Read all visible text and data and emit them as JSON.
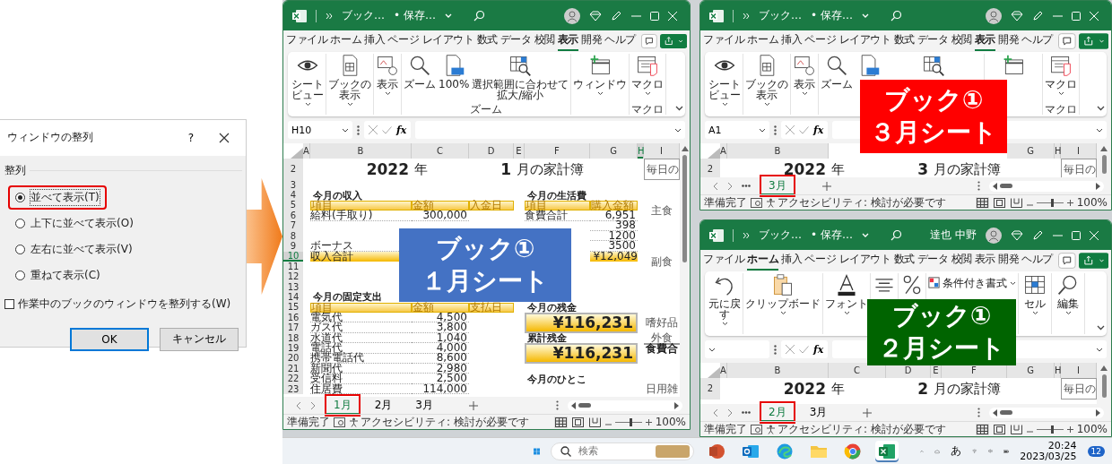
{
  "dialog": {
    "title": "ウィンドウの整列",
    "help": "?",
    "group_label": "整列",
    "options": [
      {
        "label": "並べて表示(T)",
        "selected": true,
        "highlighted": true
      },
      {
        "label": "上下に並べて表示(O)",
        "selected": false,
        "highlighted": false
      },
      {
        "label": "左右に並べて表示(V)",
        "selected": false,
        "highlighted": false
      },
      {
        "label": "重ねて表示(C)",
        "selected": false,
        "highlighted": false
      }
    ],
    "checkbox": {
      "label": "作業中のブックのウィンドウを整列する(W)",
      "checked": false
    },
    "buttons": [
      {
        "label": "OK",
        "default": true
      },
      {
        "label": "キャンセル",
        "default": false
      }
    ]
  },
  "windows": [
    {
      "title_bar": {
        "file": "ブック…",
        "save_state": "• 保存…"
      },
      "menu_tabs": [
        {
          "label": "ファイル",
          "selected": false
        },
        {
          "label": "ホーム",
          "selected": false
        },
        {
          "label": "挿入",
          "selected": false
        },
        {
          "label": "ページ レイアウト",
          "selected": false
        },
        {
          "label": "数式",
          "selected": false
        },
        {
          "label": "データ",
          "selected": false
        },
        {
          "label": "校閲",
          "selected": false
        },
        {
          "label": "表示",
          "selected": true
        },
        {
          "label": "開発",
          "selected": false
        },
        {
          "label": "ヘルプ",
          "selected": false
        }
      ],
      "ribbon_groups": [
        {
          "buttons": [
            {
              "kind": "eye",
              "label": "シートビュー",
              "dropdown": true
            }
          ]
        },
        {
          "buttons": [
            {
              "kind": "workbook",
              "label": "ブックの表示",
              "dropdown": true
            }
          ]
        },
        {
          "buttons": [
            {
              "kind": "display",
              "label": "表示",
              "dropdown": true
            }
          ]
        },
        {
          "label": "ズーム",
          "buttons": [
            {
              "kind": "zoom",
              "label": "ズーム",
              "dropdown": false
            },
            {
              "kind": "zoom100",
              "label": "100%",
              "dropdown": false
            },
            {
              "kind": "zoomsel",
              "label": "選択範囲に合わせて拡大/縮小",
              "dropdown": false
            }
          ]
        },
        {
          "buttons": [
            {
              "kind": "newwindow",
              "label": "ウィンドウ",
              "dropdown": true
            }
          ]
        },
        {
          "label": "マクロ",
          "buttons": [
            {
              "kind": "macro",
              "label": "マクロ",
              "dropdown": true
            }
          ]
        }
      ],
      "name_box": "H10",
      "fx": "fx",
      "column_headers": {
        "A": {
          "label": "A",
          "selected": false
        },
        "B": {
          "label": "B",
          "selected": false
        },
        "C": {
          "label": "C",
          "selected": false
        },
        "D": {
          "label": "D",
          "selected": false
        },
        "E": {
          "label": "E",
          "selected": false
        },
        "F": {
          "label": "F",
          "selected": false
        },
        "G": {
          "label": "G",
          "selected": false
        },
        "H": {
          "label": "H",
          "selected": true
        },
        "I": {
          "label": "I",
          "selected": false
        }
      },
      "rows": [
        {
          "num": "2",
          "selected": false,
          "cells": {
            "B": {
              "text": "2022",
              "kind": "year"
            },
            "C": {
              "text": "年",
              "kind": "title-unit"
            },
            "D": {
              "text": "1",
              "kind": "year"
            },
            "E": {
              "text": "月の家計簿",
              "kind": "title"
            },
            "I": {
              "text": "毎日の",
              "kind": "boxed"
            }
          }
        },
        {
          "num": "3",
          "selected": false
        },
        {
          "num": "4",
          "selected": false,
          "cells": {
            "B": {
              "text": "今月の収入",
              "kind": "heading"
            },
            "F": {
              "text": "今月の生活費",
              "kind": "heading"
            }
          }
        },
        {
          "num": "5",
          "selected": false,
          "cells": {
            "B": {
              "text": "項目",
              "kind": "header"
            },
            "C": {
              "text": "金額",
              "kind": "header"
            },
            "D": {
              "text": "入金日",
              "kind": "header"
            },
            "F": {
              "text": "項目",
              "kind": "header"
            },
            "G": {
              "text": "購入金額",
              "kind": "header"
            },
            "I": {
              "text": "主食",
              "kind": "side-tall"
            }
          }
        },
        {
          "num": "6",
          "selected": false,
          "cells": {
            "B": {
              "text": "給料(手取り)",
              "kind": "label"
            },
            "C": {
              "text": "300,000",
              "kind": "amount"
            },
            "F": {
              "text": "食費合計",
              "kind": "label"
            },
            "G": {
              "text": "6,951",
              "kind": "amount"
            }
          }
        },
        {
          "num": "7",
          "selected": false,
          "cells": {
            "G": {
              "text": "398",
              "kind": "amount"
            }
          }
        },
        {
          "num": "8",
          "selected": false,
          "cells": {
            "G": {
              "text": "1200",
              "kind": "amount"
            }
          }
        },
        {
          "num": "9",
          "selected": false,
          "cells": {
            "B": {
              "text": "ボーナス",
              "kind": "label"
            },
            "G": {
              "text": "3500",
              "kind": "amount"
            }
          }
        },
        {
          "num": "10",
          "selected": true,
          "cells": {
            "B": {
              "text": "収入合計",
              "kind": "total"
            },
            "G": {
              "text": "¥12,049",
              "kind": "total-amount"
            },
            "I": {
              "text": "副食",
              "kind": "side-tall"
            }
          }
        },
        {
          "num": "11",
          "selected": false
        },
        {
          "num": "12",
          "selected": false
        },
        {
          "num": "13",
          "selected": false
        },
        {
          "num": "14",
          "selected": false,
          "cells": {
            "B": {
              "text": "今月の固定支出",
              "kind": "heading"
            }
          }
        },
        {
          "num": "15",
          "selected": false,
          "cells": {
            "B": {
              "text": "項目",
              "kind": "header"
            },
            "C": {
              "text": "金額",
              "kind": "header"
            },
            "D": {
              "text": "支払日",
              "kind": "header"
            },
            "F": {
              "text": "今月の残金",
              "kind": "heading"
            }
          }
        },
        {
          "num": "16",
          "selected": false,
          "cells": {
            "B": {
              "text": "電気代",
              "kind": "label"
            },
            "C": {
              "text": "4,500",
              "kind": "amount"
            },
            "F": {
              "text": "¥116,231",
              "kind": "balance"
            },
            "I": {
              "text": "嗜好品",
              "kind": "side-tall"
            }
          }
        },
        {
          "num": "17",
          "selected": false,
          "cells": {
            "B": {
              "text": "ガス代",
              "kind": "label"
            },
            "C": {
              "text": "3,800",
              "kind": "amount"
            }
          }
        },
        {
          "num": "18",
          "selected": false,
          "cells": {
            "B": {
              "text": "水道代",
              "kind": "label"
            },
            "C": {
              "text": "1,040",
              "kind": "amount"
            },
            "F": {
              "text": "累計残金",
              "kind": "heading"
            },
            "I": {
              "text": "外食",
              "kind": "side"
            }
          }
        },
        {
          "num": "19",
          "selected": false,
          "cells": {
            "B": {
              "text": "電話代",
              "kind": "label"
            },
            "C": {
              "text": "4,000",
              "kind": "amount"
            },
            "F": {
              "text": "¥116,231",
              "kind": "balance"
            },
            "I": {
              "text": "食費合",
              "kind": "side-total"
            }
          }
        },
        {
          "num": "20",
          "selected": false,
          "cells": {
            "B": {
              "text": "携帯電話代",
              "kind": "label"
            },
            "C": {
              "text": "8,600",
              "kind": "amount"
            }
          }
        },
        {
          "num": "21",
          "selected": false,
          "cells": {
            "B": {
              "text": "新聞代",
              "kind": "label"
            },
            "C": {
              "text": "2,980",
              "kind": "amount"
            }
          }
        },
        {
          "num": "22",
          "selected": false,
          "cells": {
            "B": {
              "text": "受信料",
              "kind": "label"
            },
            "C": {
              "text": "2,500",
              "kind": "amount"
            },
            "F": {
              "text": "今月のひとこ",
              "kind": "heading"
            }
          }
        },
        {
          "num": "23",
          "selected": false,
          "cells": {
            "B": {
              "text": "住居費",
              "kind": "label"
            },
            "C": {
              "text": "114,000",
              "kind": "amount"
            },
            "I": {
              "text": "日用雑",
              "kind": "side"
            }
          }
        }
      ],
      "sheet_tabs": {
        "overflow": false,
        "tabs": [
          {
            "label": "1月",
            "selected": true,
            "highlighted": true
          },
          {
            "label": "2月",
            "selected": false,
            "highlighted": false
          },
          {
            "label": "3月",
            "selected": false,
            "highlighted": false
          }
        ]
      },
      "status": {
        "ready": "準備完了",
        "accessibility": "アクセシビリティ: 検討が必要です",
        "views": [
          {
            "kind": "normal",
            "selected": true
          },
          {
            "kind": "layout",
            "selected": false
          },
          {
            "kind": "break",
            "selected": false
          }
        ],
        "zoom": {
          "level": 0.55
        },
        "zoom_text": "100%"
      },
      "callout": {
        "color": "#4472c4",
        "lines": [
          "ブック①",
          "１月シート"
        ]
      }
    },
    {
      "title_bar": {
        "file": "ブック…",
        "save_state": "• 保存…"
      },
      "menu_tabs": [
        {
          "label": "ファイル",
          "selected": false
        },
        {
          "label": "ホーム",
          "selected": false
        },
        {
          "label": "挿入",
          "selected": false
        },
        {
          "label": "ページ レイアウト",
          "selected": false
        },
        {
          "label": "数式",
          "selected": false
        },
        {
          "label": "データ",
          "selected": false
        },
        {
          "label": "校閲",
          "selected": false
        },
        {
          "label": "表示",
          "selected": true
        },
        {
          "label": "開発",
          "selected": false
        },
        {
          "label": "ヘルプ",
          "selected": false
        }
      ],
      "ribbon_groups": [
        {
          "buttons": [
            {
              "kind": "eye",
              "label": "シートビュー",
              "dropdown": true
            }
          ]
        },
        {
          "buttons": [
            {
              "kind": "workbook",
              "label": "ブックの表示",
              "dropdown": true
            }
          ]
        },
        {
          "buttons": [
            {
              "kind": "display",
              "label": "表示",
              "dropdown": true
            }
          ]
        },
        {
          "buttons": [
            {
              "kind": "zoom",
              "label": "ズーム",
              "dropdown": false
            },
            {
              "kind": "zoom100",
              "dropdown": false
            },
            {
              "kind": "zoomsel",
              "dropdown": false
            }
          ]
        },
        {
          "buttons": [
            {
              "kind": "newwindow",
              "dropdown": false
            }
          ]
        },
        {
          "label": "マクロ",
          "buttons": [
            {
              "kind": "macro",
              "label": "マクロ",
              "dropdown": true
            }
          ]
        }
      ],
      "name_box": "A1",
      "fx": "fx",
      "column_headers": {
        "A": {
          "label": "A",
          "selected": false
        },
        "B": {
          "label": "B",
          "selected": false
        },
        "G": {
          "label": "G",
          "selected": false
        },
        "H": {
          "label": "H",
          "selected": false
        },
        "I": {
          "label": "I",
          "selected": false
        }
      },
      "rows": [
        {
          "num": "2",
          "selected": false,
          "cells": {
            "B": {
              "text": "2022",
              "kind": "year"
            },
            "C": {
              "text": "年",
              "kind": "title-unit"
            },
            "D": {
              "text": "3",
              "kind": "year"
            },
            "E": {
              "text": "月の家計簿",
              "kind": "title"
            },
            "I": {
              "text": "毎日の",
              "kind": "boxed"
            }
          }
        }
      ],
      "sheet_tabs": {
        "overflow": true,
        "tabs": [
          {
            "label": "3月",
            "selected": true,
            "highlighted": true
          }
        ]
      },
      "status": {
        "ready": "準備完了",
        "accessibility": "アクセシビリティ: 検討が必要です",
        "views": [
          {
            "kind": "normal",
            "selected": true
          },
          {
            "kind": "layout",
            "selected": false
          },
          {
            "kind": "break",
            "selected": false
          }
        ],
        "zoom": {
          "level": 0.55
        },
        "zoom_text": "100%"
      },
      "callout": {
        "color": "#ff0000",
        "lines": [
          "ブック①",
          "３月シート"
        ]
      }
    },
    {
      "title_bar": {
        "file": "ブック…",
        "save_state": "• 保存…",
        "user": "達也 中野"
      },
      "menu_tabs": [
        {
          "label": "ファイル",
          "selected": false
        },
        {
          "label": "ホーム",
          "selected": true
        },
        {
          "label": "挿入",
          "selected": false
        },
        {
          "label": "ページ レイアウト",
          "selected": false
        },
        {
          "label": "数式",
          "selected": false
        },
        {
          "label": "データ",
          "selected": false
        },
        {
          "label": "校閲",
          "selected": false
        },
        {
          "label": "表示",
          "selected": false
        },
        {
          "label": "開発",
          "selected": false
        },
        {
          "label": "ヘルプ",
          "selected": false
        }
      ],
      "ribbon_groups": [
        {
          "buttons": [
            {
              "kind": "undo",
              "label": "元に戻す",
              "dropdown": true
            }
          ]
        },
        {
          "buttons": [
            {
              "kind": "clipboard",
              "label": "クリップボード",
              "dropdown": true
            }
          ]
        },
        {
          "buttons": [
            {
              "kind": "font",
              "label": "フォント",
              "dropdown": true
            }
          ]
        },
        {
          "buttons": [
            {
              "kind": "align",
              "dropdown": false
            }
          ]
        },
        {
          "buttons": [
            {
              "kind": "percent",
              "dropdown": false
            }
          ]
        },
        {
          "buttons": [
            {
              "kind": "condformat",
              "label": "条件付き書式",
              "dropdown": true
            }
          ]
        },
        {
          "buttons": [
            {
              "kind": "cells",
              "label": "セル",
              "dropdown": true
            }
          ]
        },
        {
          "buttons": [
            {
              "kind": "find",
              "label": "編集",
              "dropdown": true
            }
          ]
        }
      ],
      "fx": "fx",
      "column_headers": {
        "A": {
          "label": "A",
          "selected": false
        },
        "B": {
          "label": "B",
          "selected": false
        },
        "C": {
          "label": "C",
          "selected": false
        },
        "D": {
          "label": "D",
          "selected": false
        },
        "E": {
          "label": "E",
          "selected": false
        },
        "F": {
          "label": "F",
          "selected": false
        },
        "G": {
          "label": "G",
          "selected": false
        },
        "H": {
          "label": "H",
          "selected": false
        },
        "I": {
          "label": "I",
          "selected": false
        }
      },
      "rows": [
        {
          "num": "2",
          "selected": false,
          "cells": {
            "B": {
              "text": "2022",
              "kind": "year"
            },
            "C": {
              "text": "年",
              "kind": "title-unit"
            },
            "D": {
              "text": "2",
              "kind": "year"
            },
            "E": {
              "text": "月の家計簿",
              "kind": "title"
            },
            "I": {
              "text": "毎日の",
              "kind": "boxed"
            }
          }
        }
      ],
      "sheet_tabs": {
        "overflow": true,
        "tabs": [
          {
            "label": "2月",
            "selected": true,
            "highlighted": true
          },
          {
            "label": "3月",
            "selected": false,
            "highlighted": false
          }
        ]
      },
      "status": {
        "ready": "準備完了",
        "accessibility": "アクセシビリティ: 検討が必要です",
        "views": [
          {
            "kind": "normal",
            "selected": true
          },
          {
            "kind": "layout",
            "selected": false
          },
          {
            "kind": "break",
            "selected": false
          }
        ],
        "zoom": {
          "level": 0.55
        },
        "zoom_text": "100%"
      },
      "callout": {
        "color": "#006400",
        "lines": [
          "ブック①",
          "２月シート"
        ]
      }
    }
  ],
  "taskbar": {
    "search": {
      "placeholder": "検索"
    },
    "apps": [
      {
        "kind": "presentation",
        "active": false
      },
      {
        "kind": "mail",
        "active": false
      },
      {
        "kind": "browser",
        "active": false
      },
      {
        "kind": "folder",
        "active": false
      },
      {
        "kind": "globe",
        "active": false
      },
      {
        "kind": "spreadsheet",
        "active": true
      }
    ],
    "ime": "あ",
    "time": "20:24",
    "date": "2023/03/25",
    "badge": "12"
  }
}
